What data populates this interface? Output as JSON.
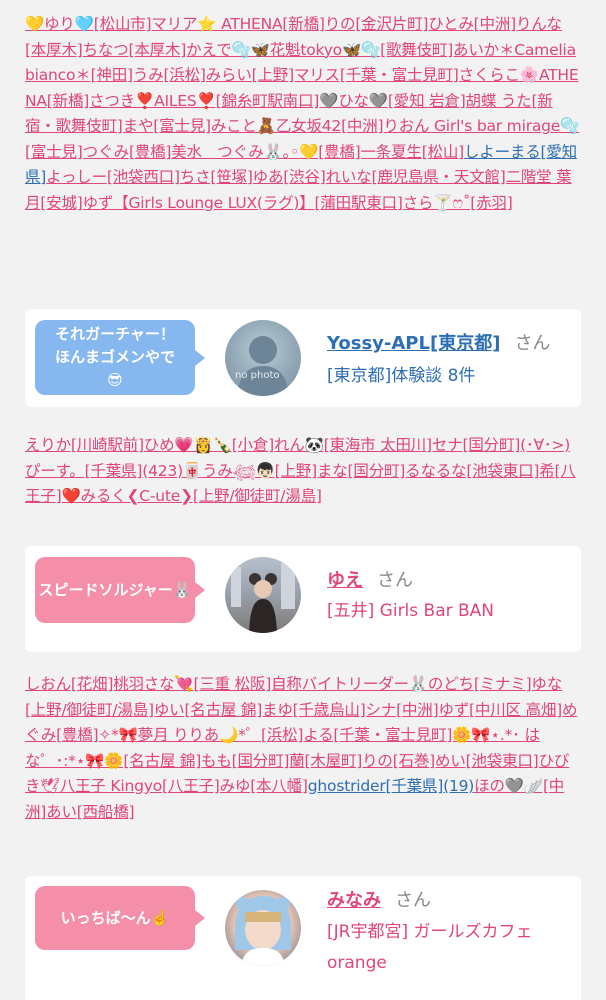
{
  "lists": {
    "list1": [
      "💛ゆり🩵[松山市]マリア⭐ ATHENA[新橋]りの[金沢片町]ひとみ[中洲]りんな[本厚木]ちなつ[本厚木]かえで🫧🦋花魁tokyo🦋🫧[歌舞伎町]あいか＊Camelia bianco＊[神田]うみ[浜松]みらい[上野]マリス[千葉・富士見町]さくらこ🌸ATHENA[新橋]さつき❣️AILES❣️[錦糸町駅南口]🩶ひな🩶[愛知 岩倉]胡蝶 うた[新宿・歌舞伎町]まや[富士見]みこと🧸乙女坂42[中洲]りおん Girl's bar mirage🫧[富士見]つぐみ[豊橋]美水　つぐみ🐰｡◦💛[豊橋]一条夏生[松山]",
      "しよーまる[愛知県]",
      "よっしー[池袋西口]ちさ[笹塚]ゆあ[渋谷]れいな[鹿児島県・天文館]二階堂 葉月[安城]ゆず【Girls Lounge LUX(ラグ)】[蒲田駅東口]さら🍸ෆ˚[赤羽]"
    ],
    "list2": "えりか[川崎駅前]ひめ💗👸🍾[小倉]れん🐼[東海市 太田川]セナ[国分町](･∀･>)ぴーす。[千葉県](423)🀄うみ𓆉👦🏻[上野]まな[国分町]るなるな[池袋東口]希[八王子]❤️みるく❮C-ute❯[上野/御徒町/湯島]",
    "list3": [
      "しおん[花畑]桃羽さな💘[三重 松阪]自称バイトリーダー🐰のどち[ミナミ]ゆな[上野/御徒町/湯島]ゆい[名古屋 錦]まゆ[千歳烏山]シナ[中洲]ゆず[中川区 高畑]めぐみ[豊橋]✧*🎀夢月 りりあ🌙*゜[浜松]よる[千葉・富士見町]🌼🎀⋆.*･ はな゜･:*⋆🎀🌼[名古屋 錦]もも[国分町]蘭[木屋町]りの[石巻]めい[池袋東口]ひびき🕊八王子 Kingyo[八王子]みゆ[本八幡]",
      "ghostrider[千葉県](19)",
      "ほの🩶🪽[中洲]あい[西船橋]"
    ]
  },
  "cards": [
    {
      "bubble": "それガーチャー！\nほんまゴメンやで\n😎",
      "avatar_text": "no photo",
      "name": "Yossy-APL[東京都]",
      "san": "さん",
      "desc": "[東京都]体験談 8件",
      "accent": "#2e6fb3"
    },
    {
      "bubble": "スピードソルジャー🐰",
      "name": "ゆえ",
      "san": "さん",
      "desc": "[五井] Girls Bar BAN",
      "accent": "#e0457b"
    },
    {
      "bubble": "いっちば〜ん☝️",
      "name": "みなみ",
      "san": "さん",
      "desc": "[JR宇都宮] ガールズカフェorange",
      "accent": "#e0457b"
    }
  ]
}
